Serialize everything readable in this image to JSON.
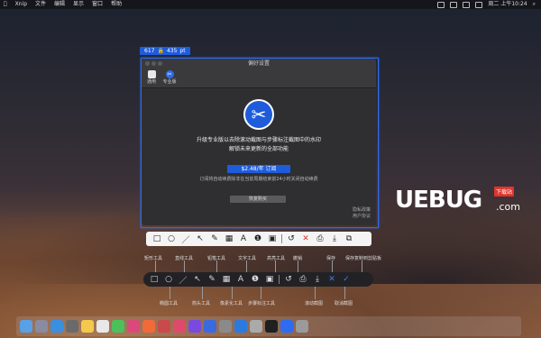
{
  "menubar": {
    "app_name": "Xnip",
    "menus": [
      "文件",
      "编辑",
      "显示",
      "窗口",
      "帮助"
    ],
    "clock": "周二 上午10:24"
  },
  "size_tag": {
    "width": "617",
    "lock": "🔒",
    "height": "435",
    "unit": "pt"
  },
  "prefs": {
    "title": "偏好设置",
    "tabs": [
      {
        "label": "通用"
      },
      {
        "label": "专业版"
      }
    ],
    "upgrade_line1": "升级专业版以去除滚动截图与步骤标注截图中的水印",
    "upgrade_line2": "解锁未来更新的全部功能",
    "subscribe_button": "$2.48/年 订阅",
    "note": "订阅将自动续费除非在当前周期结束前24小时关闭自动续费",
    "restore_button": "恢复购买",
    "link_privacy": "隐私政策",
    "link_terms": "用户协议"
  },
  "labels_top": [
    "矩形工具",
    "直线工具",
    "铅笔工具",
    "文字工具",
    "高亮工具",
    "撤销",
    "保存",
    "保存复制到剪贴板"
  ],
  "labels_bottom": [
    "椭圆工具",
    "箭头工具",
    "像素化工具",
    "步骤标注工具",
    "滚动截图",
    "取消截图"
  ],
  "watermark": {
    "text": "UEBUG",
    "domain": ".com",
    "badge": "下载站"
  },
  "colors": {
    "accent": "#1e5cdc",
    "cancel": "#e0342d",
    "confirm": "#3a7cf0"
  }
}
